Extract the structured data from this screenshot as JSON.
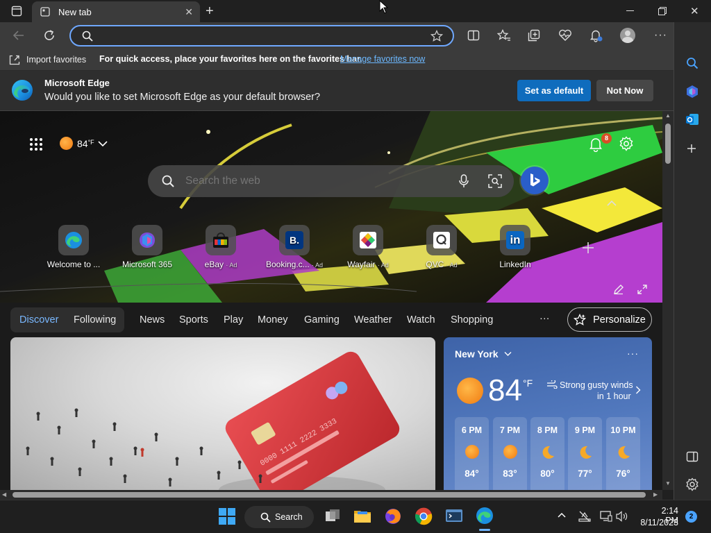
{
  "tab": {
    "title": "New tab"
  },
  "address": {
    "value": "",
    "placeholder": ""
  },
  "favorites_bar": {
    "import_label": "Import favorites",
    "hint": "For quick access, place your favorites here on the favorites bar.",
    "manage_link": "Manage favorites now"
  },
  "banner": {
    "product": "Microsoft Edge",
    "question": "Would you like to set Microsoft Edge as your default browser?",
    "set_default": "Set as default",
    "not_now": "Not Now"
  },
  "newtab": {
    "weather_temp": "84",
    "weather_unit": "°F",
    "notification_count": "8",
    "search_placeholder": "Search the web",
    "shortcuts": [
      {
        "label": "Welcome to ...",
        "ad": ""
      },
      {
        "label": "Microsoft 365",
        "ad": ""
      },
      {
        "label": "eBay",
        "ad": "· Ad"
      },
      {
        "label": "Booking.c...",
        "ad": "· Ad"
      },
      {
        "label": "Wayfair",
        "ad": "· Ad"
      },
      {
        "label": "QVC",
        "ad": "· Ad"
      },
      {
        "label": "LinkedIn",
        "ad": ""
      }
    ]
  },
  "feed_nav": {
    "discover": "Discover",
    "following": "Following",
    "items": [
      "News",
      "Sports",
      "Play",
      "Money",
      "Gaming",
      "Weather",
      "Watch",
      "Shopping"
    ],
    "more": "···",
    "personalize": "Personalize"
  },
  "weather_card": {
    "city": "New York",
    "temp": "84",
    "unit": "°F",
    "alert_line1": "Strong gusty winds",
    "alert_line2": "in 1 hour",
    "hourly": [
      {
        "time": "6 PM",
        "temp": "84°",
        "icon": "sun-icon"
      },
      {
        "time": "7 PM",
        "temp": "83°",
        "icon": "sun-icon"
      },
      {
        "time": "8 PM",
        "temp": "80°",
        "icon": "moon-icon"
      },
      {
        "time": "9 PM",
        "temp": "77°",
        "icon": "moon-icon"
      },
      {
        "time": "10 PM",
        "temp": "76°",
        "icon": "moon-icon"
      }
    ]
  },
  "taskbar": {
    "search_label": "Search",
    "time": "2:14 PM",
    "date": "8/11/2023",
    "notification_badge": "2"
  },
  "colors": {
    "accent": "#0f6cbd",
    "link": "#6cb8ff",
    "address_border": "#6fa8ff",
    "badge": "#d74e26"
  }
}
